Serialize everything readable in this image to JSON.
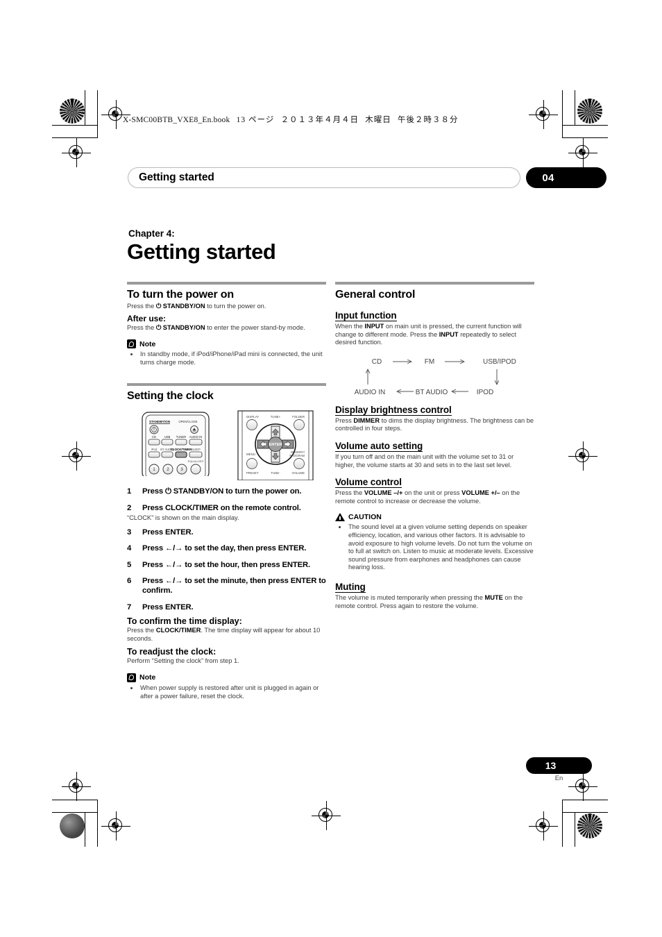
{
  "print_header": {
    "file_line": "X-SMC00BTB_VXE8_En.book",
    "page_marker": "13 ページ",
    "date_marker": "２０１３年４月４日",
    "weekday_marker": "木曜日",
    "time_marker": "午後２時３８分"
  },
  "running_head": {
    "title": "Getting started",
    "chapter_number": "04"
  },
  "chapter": {
    "label": "Chapter 4:",
    "title": "Getting started"
  },
  "left_column": {
    "power_section": {
      "heading": "To turn the power on",
      "intro_prefix": "Press the ",
      "intro_bold": "⏻ STANDBY/ON",
      "intro_suffix": " to turn the power on.",
      "after_use_heading": "After use:",
      "after_use_prefix": "Press the ",
      "after_use_bold": "⏻ STANDBY/ON",
      "after_use_suffix": " to enter the power stand-by mode.",
      "note_label": "Note",
      "note_bullets": [
        "In standby mode, if iPod/iPhone/iPad mini is connected, the unit turns charge mode."
      ]
    },
    "clock_section": {
      "heading": "Setting the clock",
      "remote_left": {
        "top_left_label": "STANDBY/ON",
        "top_right_label": "OPEN/CLOSE",
        "row1": [
          "CD",
          "USB",
          "TUNER",
          "AUDIO IN"
        ],
        "row2": [
          "iPod",
          "BT AUDIO",
          "CLOCK/TIMER",
          "SLEEP"
        ],
        "row3_label": "EQUALIZER",
        "numbers": [
          "1",
          "2",
          "3"
        ]
      },
      "remote_right": {
        "top_labels": [
          "DISPLAY",
          "TUNE+",
          "FOLDER"
        ],
        "mid_labels": [
          "MENU",
          "MEMORY/PROGRAM"
        ],
        "bottom_labels": [
          "PRESET",
          "TUNE-",
          "VOLUME"
        ],
        "center_button": "ENTER"
      },
      "steps": [
        {
          "n": "1",
          "text": "Press ⏻ STANDBY/ON to turn the power on.",
          "note": ""
        },
        {
          "n": "2",
          "text": "Press CLOCK/TIMER on the remote control.",
          "note": "“CLOCK” is shown on the main display."
        },
        {
          "n": "3",
          "text": "Press ENTER.",
          "note": ""
        },
        {
          "n": "4",
          "text": "Press ←/→ to set the day, then press ENTER.",
          "note": ""
        },
        {
          "n": "5",
          "text": "Press ←/→ to set the hour, then press ENTER.",
          "note": ""
        },
        {
          "n": "6",
          "text": "Press ←/→ to set the minute, then press ENTER to confirm.",
          "note": ""
        },
        {
          "n": "7",
          "text": "Press ENTER.",
          "note": ""
        }
      ],
      "confirm_heading": "To confirm the time display:",
      "confirm_prefix": "Press the ",
      "confirm_bold": "CLOCK/TIMER",
      "confirm_suffix": ". The time display will appear for about 10 seconds.",
      "readjust_heading": "To readjust the clock:",
      "readjust_body": "Perform “Setting the clock” from step 1.",
      "note_label": "Note",
      "note_bullets": [
        "When power supply is restored after unit is plugged in again or after a power failure, reset the clock."
      ]
    }
  },
  "right_column": {
    "general_heading": "General control",
    "input_function": {
      "heading": "Input function",
      "body_part1": "When the ",
      "body_bold1": "INPUT",
      "body_part2": " on main unit is pressed, the current function will change to different mode. Press the ",
      "body_bold2": "INPUT",
      "body_part3": " repeatedly to select desired function.",
      "cycle": [
        "CD",
        "FM",
        "USB/IPOD",
        "IPOD",
        "BT AUDIO",
        "AUDIO IN"
      ]
    },
    "display_brightness": {
      "heading": "Display brightness control",
      "body_prefix": "Press ",
      "body_bold": "DIMMER",
      "body_suffix": " to dims the display brightness. The brightness can be controlled in four steps."
    },
    "volume_auto": {
      "heading": "Volume auto setting",
      "body": "If you turn off and on the main unit with the volume set to 31 or higher, the volume starts at 30 and sets in to the last set level."
    },
    "volume_control": {
      "heading": "Volume control",
      "body_prefix": "Press the ",
      "body_bold1": "VOLUME –/+",
      "body_mid": " on the unit or press ",
      "body_bold2": "VOLUME +/–",
      "body_suffix": " on the remote control to increase or decrease the volume.",
      "caution_label": "CAUTION",
      "caution_bullets": [
        "The sound level at a given volume setting depends on speaker efficiency, location, and various other factors. It is advisable to avoid exposure to high volume levels. Do not turn the volume on to full at switch on. Listen to music at moderate levels. Excessive sound pressure from earphones and headphones can cause hearing loss."
      ]
    },
    "muting": {
      "heading": "Muting",
      "body_prefix": "The volume is muted temporarily when pressing the ",
      "body_bold": "MUTE",
      "body_suffix": " on the remote control. Press again to restore the volume."
    }
  },
  "footer": {
    "page_number": "13",
    "language": "En"
  }
}
